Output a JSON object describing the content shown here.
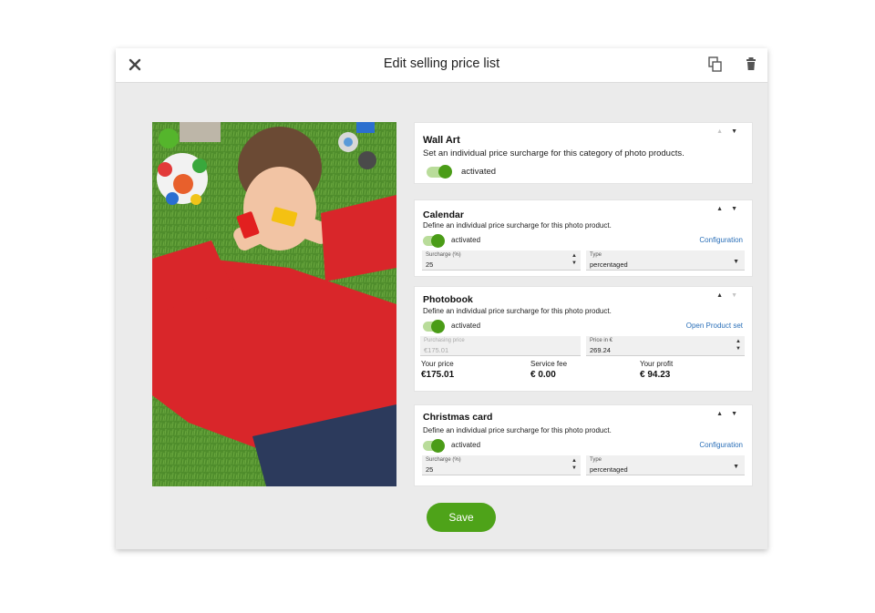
{
  "header": {
    "title": "Edit selling price list"
  },
  "cards": [
    {
      "title": "Wall Art",
      "description": "Set an individual price surcharge for this category of photo products.",
      "toggle_label": "activated"
    },
    {
      "title": "Calendar",
      "description": "Define an individual price surcharge for this photo product.",
      "toggle_label": "activated",
      "link": "Configuration",
      "fields": [
        {
          "label": "Surcharge (%)",
          "value": "25"
        },
        {
          "label": "Type",
          "value": "percentaged"
        }
      ]
    },
    {
      "title": "Photobook",
      "description": "Define an individual price surcharge for this photo product.",
      "toggle_label": "activated",
      "link": "Open Product set",
      "fields": [
        {
          "label": "Purchasing price",
          "value": "€175.01"
        },
        {
          "label": "Price in €",
          "value": "269.24"
        }
      ],
      "stats": [
        {
          "label": "Your price",
          "value": "€175.01"
        },
        {
          "label": "Service fee",
          "value": "€ 0.00"
        },
        {
          "label": "Your profit",
          "value": "€ 94.23"
        }
      ]
    },
    {
      "title": "Christmas card",
      "description": "Define an individual price surcharge for this photo product.",
      "toggle_label": "activated",
      "link": "Configuration",
      "fields": [
        {
          "label": "Surcharge (%)",
          "value": "25"
        },
        {
          "label": "Type",
          "value": "percentaged"
        }
      ]
    }
  ],
  "save_label": "Save",
  "icons": {
    "close": "close-icon",
    "copy": "copy-icon",
    "delete": "trash-icon"
  },
  "colors": {
    "accent": "#4ea319",
    "link": "#2a6fb8",
    "toggle_knob": "#4a9c17"
  }
}
